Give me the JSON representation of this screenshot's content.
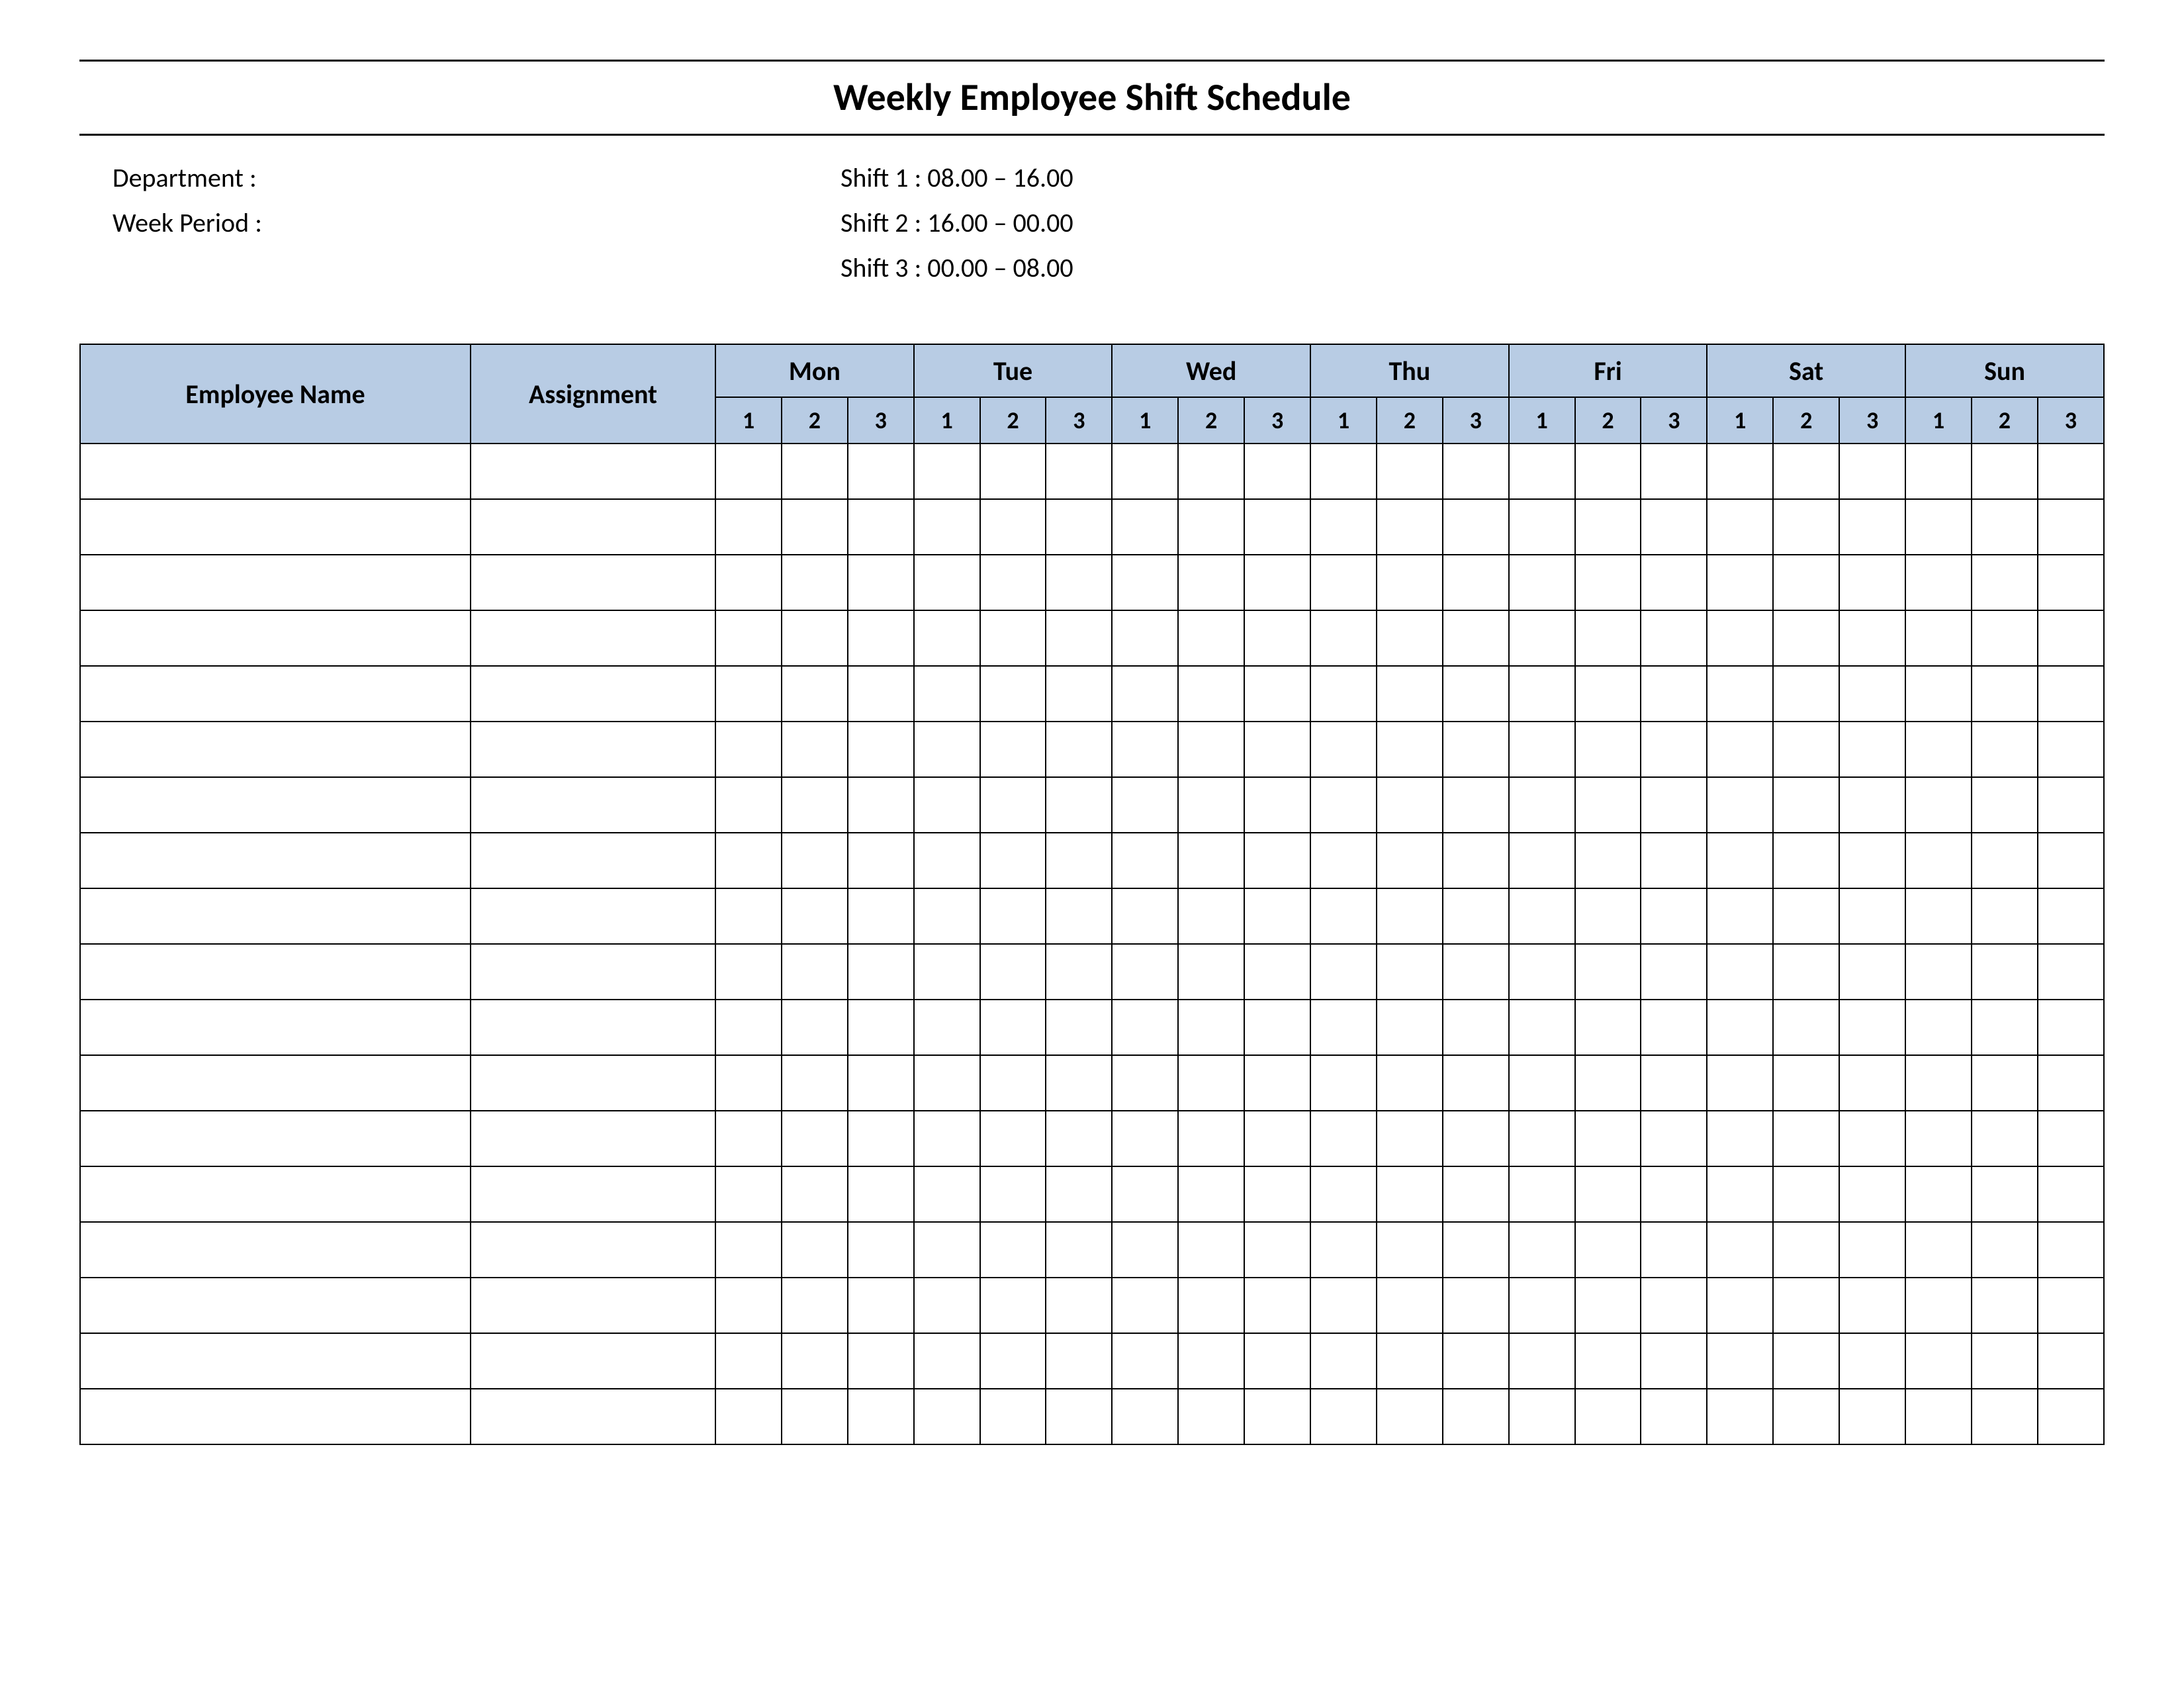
{
  "title": "Weekly Employee Shift Schedule",
  "meta": {
    "department_label": "Department    :",
    "week_label": "Week  Period :",
    "shift1": "Shift 1  : 08.00  – 16.00",
    "shift2": "Shift 2  : 16.00  – 00.00",
    "shift3": "Shift 3  : 00.00  – 08.00"
  },
  "headers": {
    "name": "Employee Name",
    "assign": "Assignment",
    "days": [
      "Mon",
      "Tue",
      "Wed",
      "Thu",
      "Fri",
      "Sat",
      "Sun"
    ],
    "shifts": [
      "1",
      "2",
      "3"
    ]
  },
  "row_count": 18
}
